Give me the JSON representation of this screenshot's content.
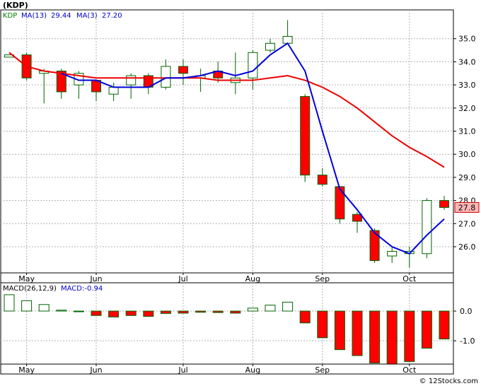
{
  "chart_data": [
    {
      "type": "candlestick",
      "ticker": "KDP",
      "legend": [
        {
          "label": "KDP",
          "color": "#008000"
        },
        {
          "label": "MA(13)",
          "value": "29.44",
          "color": "#0000cc"
        },
        {
          "label": "MA(3)",
          "value": "27.20",
          "color": "#0000cc"
        }
      ],
      "ylim": [
        25.0,
        36.0
      ],
      "yticks": [
        "26.0",
        "27.0",
        "28.0",
        "29.0",
        "30.0",
        "31.0",
        "32.0",
        "33.0",
        "34.0",
        "35.0"
      ],
      "xticks": [
        "May",
        "Jun",
        "Jul",
        "Aug",
        "Sep",
        "Oct"
      ],
      "last_price_label": "27.8",
      "candles": [
        {
          "o": 34.2,
          "c": 34.3,
          "h": 34.3,
          "l": 34.2
        },
        {
          "o": 34.3,
          "c": 33.3,
          "h": 34.4,
          "l": 33.2
        },
        {
          "o": 33.5,
          "c": 33.6,
          "h": 33.7,
          "l": 32.2
        },
        {
          "o": 33.6,
          "c": 32.7,
          "h": 33.7,
          "l": 32.4
        },
        {
          "o": 33.0,
          "c": 33.5,
          "h": 33.6,
          "l": 32.4
        },
        {
          "o": 33.2,
          "c": 32.7,
          "h": 33.2,
          "l": 32.3
        },
        {
          "o": 32.6,
          "c": 32.9,
          "h": 33.1,
          "l": 32.3
        },
        {
          "o": 33.0,
          "c": 33.4,
          "h": 33.5,
          "l": 32.4
        },
        {
          "o": 33.4,
          "c": 32.9,
          "h": 33.5,
          "l": 32.6
        },
        {
          "o": 32.9,
          "c": 33.8,
          "h": 34.1,
          "l": 32.8
        },
        {
          "o": 33.8,
          "c": 33.5,
          "h": 34.1,
          "l": 33.0
        },
        {
          "o": 33.3,
          "c": 33.4,
          "h": 33.7,
          "l": 32.7
        },
        {
          "o": 33.6,
          "c": 33.3,
          "h": 34.0,
          "l": 33.1
        },
        {
          "o": 33.1,
          "c": 33.3,
          "h": 34.4,
          "l": 32.6
        },
        {
          "o": 33.3,
          "c": 34.4,
          "h": 34.5,
          "l": 32.8
        },
        {
          "o": 34.5,
          "c": 34.8,
          "h": 35.0,
          "l": 34.4
        },
        {
          "o": 34.8,
          "c": 35.1,
          "h": 35.8,
          "l": 34.8
        },
        {
          "o": 32.5,
          "c": 29.1,
          "h": 32.6,
          "l": 28.8
        },
        {
          "o": 29.1,
          "c": 28.7,
          "h": 29.4,
          "l": 28.6
        },
        {
          "o": 28.6,
          "c": 27.2,
          "h": 28.6,
          "l": 27.0
        },
        {
          "o": 27.4,
          "c": 27.1,
          "h": 27.5,
          "l": 26.6
        },
        {
          "o": 26.7,
          "c": 25.4,
          "h": 26.8,
          "l": 25.3
        },
        {
          "o": 25.6,
          "c": 25.8,
          "h": 26.0,
          "l": 25.3
        },
        {
          "o": 25.7,
          "c": 25.8,
          "h": 26.0,
          "l": 25.1
        },
        {
          "o": 25.7,
          "c": 28.0,
          "h": 28.1,
          "l": 25.5
        },
        {
          "o": 28.0,
          "c": 27.7,
          "h": 28.2,
          "l": 27.6
        }
      ],
      "ma3": [
        null,
        null,
        null,
        33.5,
        33.2,
        33.2,
        32.9,
        32.9,
        32.9,
        33.3,
        33.3,
        33.4,
        33.6,
        33.4,
        33.6,
        34.3,
        34.8,
        33.6,
        31.0,
        28.5,
        27.6,
        26.6,
        26.0,
        25.7,
        26.5,
        27.2
      ],
      "ma13": [
        34.4,
        33.8,
        33.6,
        33.5,
        33.4,
        33.3,
        33.3,
        33.3,
        33.3,
        33.3,
        33.3,
        33.3,
        33.2,
        33.2,
        33.2,
        33.3,
        33.4,
        33.2,
        32.9,
        32.5,
        32.0,
        31.4,
        30.8,
        30.3,
        29.9,
        29.44
      ]
    },
    {
      "type": "bar",
      "legend": [
        {
          "label": "MACD(26,12,9)",
          "color": "#000000"
        },
        {
          "label": "MACD:-0.94",
          "color": "#0000cc"
        }
      ],
      "ylim": [
        -1.8,
        0.75
      ],
      "yticks": [
        "0.0",
        "-1.0"
      ],
      "xticks": [
        "May",
        "Jun",
        "Jul",
        "Aug",
        "Sep",
        "Oct"
      ],
      "values": [
        0.55,
        0.35,
        0.22,
        0.03,
        0.0,
        -0.15,
        -0.2,
        -0.15,
        -0.18,
        -0.08,
        -0.07,
        -0.04,
        -0.05,
        -0.07,
        0.1,
        0.2,
        0.3,
        -0.4,
        -0.9,
        -1.3,
        -1.5,
        -1.75,
        -1.8,
        -1.7,
        -1.25,
        -0.94
      ]
    }
  ],
  "credit": "© 12Stocks.com"
}
